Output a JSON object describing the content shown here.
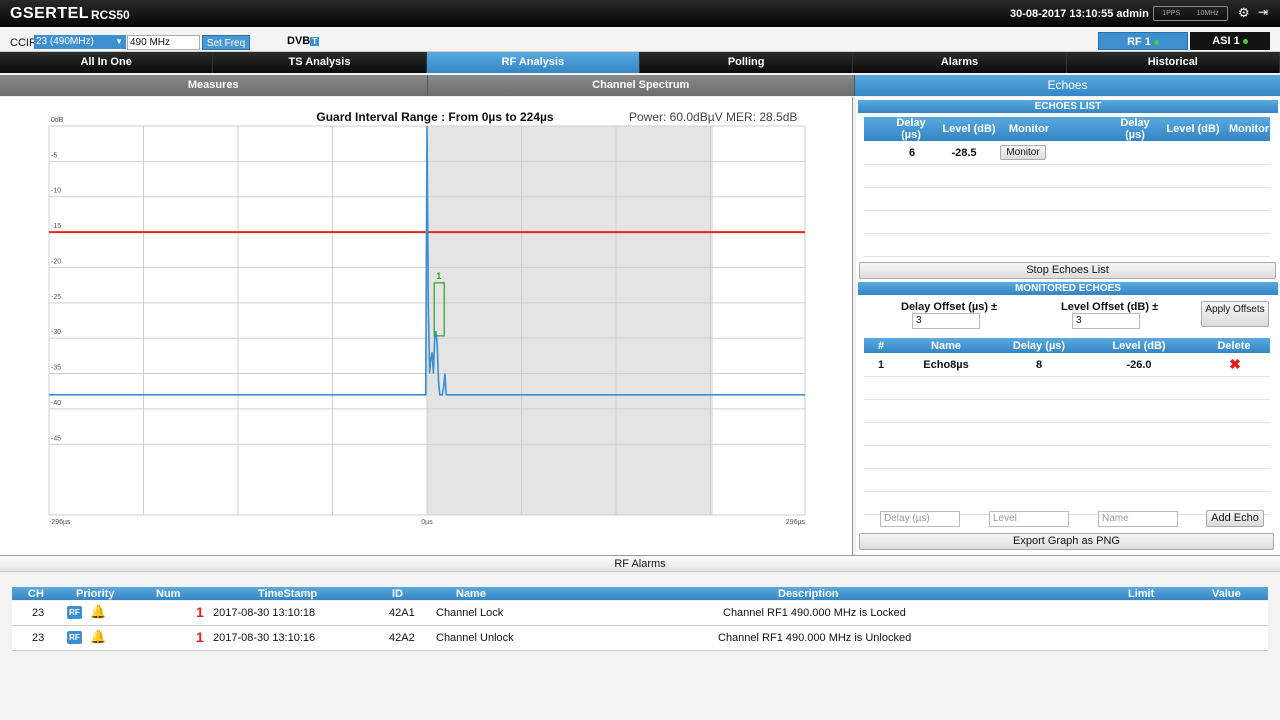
{
  "header": {
    "brand": "GSERTEL",
    "model": "RCS50",
    "datetime": "30-08-2017 13:10:55",
    "user": "admin",
    "pps_label": "1PPS",
    "ref_label": "10MHz"
  },
  "freqbar": {
    "ccir_label": "CCIR",
    "ccir_value": "23 (490MHz)",
    "freq_value": "490 MHz",
    "set_freq_label": "Set Freq",
    "dvb_label": "DVB",
    "dvb_suffix": "T",
    "rf_button": "RF 1",
    "asi_button": "ASI 1"
  },
  "main_tabs": [
    "All In One",
    "TS Analysis",
    "RF Analysis",
    "Polling",
    "Alarms",
    "Historical"
  ],
  "active_main_tab": "RF Analysis",
  "sub_tabs": [
    "Measures",
    "Channel Spectrum"
  ],
  "echoes_tab": "Echoes",
  "chart": {
    "title": "Guard Interval Range : From 0µs to 224µs",
    "power": "Power: 60.0dBµV",
    "mer": "MER: 28.5dB"
  },
  "chart_data": {
    "type": "line",
    "title": "Guard Interval Range : From 0µs to 224µs",
    "xlabel": "",
    "ylabel": "",
    "xlim": [
      -296,
      296
    ],
    "ylim": [
      -55,
      0
    ],
    "y_ticks": [
      "0dB",
      "-5",
      "-10",
      "-15",
      "-20",
      "-25",
      "-30",
      "-35",
      "-40",
      "-45"
    ],
    "x_ticks": [
      "-296µs",
      "0µs",
      "296µs"
    ],
    "threshold_db": -15,
    "guard_interval_us": [
      0,
      224
    ],
    "marker": {
      "label": "1",
      "delay_us": 8,
      "level_db": -26
    },
    "grid": true,
    "series": [
      {
        "x": [
          -296,
          -1,
          0,
          1,
          2,
          3,
          4,
          5,
          6,
          7,
          8,
          9,
          10,
          11,
          12,
          13,
          14,
          15,
          16,
          296
        ],
        "y": [
          -38,
          -38,
          0,
          -25,
          -35,
          -33,
          -32,
          -35,
          -30,
          -29,
          -31,
          -36,
          -38,
          -38,
          -38,
          -37,
          -35,
          -38,
          -38,
          -38
        ]
      }
    ]
  },
  "echoes_list": {
    "header": "ECHOES LIST",
    "columns": [
      "Delay (µs)",
      "Level (dB)",
      "Monitor",
      "Delay (µs)",
      "Level (dB)",
      "Monitor"
    ],
    "rows": [
      {
        "delay": "6",
        "level": "-28.5",
        "monitor": "Monitor"
      }
    ],
    "stop_button": "Stop Echoes List"
  },
  "monitored_echoes": {
    "header": "MONITORED ECHOES",
    "delay_offset_label": "Delay Offset (µs) ±",
    "delay_offset_value": "3",
    "level_offset_label": "Level Offset (dB) ±",
    "level_offset_value": "3",
    "apply_button": "Apply Offsets",
    "columns": [
      "#",
      "Name",
      "Delay (µs)",
      "Level (dB)",
      "Delete"
    ],
    "rows": [
      {
        "num": "1",
        "name": "Echo8µs",
        "delay": "8",
        "level": "-26.0"
      }
    ],
    "delay_placeholder": "Delay (µs)",
    "level_placeholder": "Level",
    "name_placeholder": "Name",
    "add_button": "Add Echo",
    "export_button": "Export Graph as PNG"
  },
  "alarms": {
    "title": "RF Alarms",
    "columns": [
      "CH",
      "Priority",
      "Num",
      "TimeStamp",
      "ID",
      "Name",
      "Description",
      "Limit",
      "Value"
    ],
    "rows": [
      {
        "ch": "23",
        "badge": "RF",
        "num": "1",
        "timestamp": "2017-08-30 13:10:18",
        "id": "42A1",
        "name": "Channel Lock",
        "description": "Channel RF1 490.000 MHz is Locked",
        "limit": "",
        "value": ""
      },
      {
        "ch": "23",
        "badge": "RF",
        "num": "1",
        "timestamp": "2017-08-30 13:10:16",
        "id": "42A2",
        "name": "Channel Unlock",
        "description": "Channel RF1 490.000 MHz is Unlocked",
        "limit": "",
        "value": ""
      }
    ]
  },
  "colors": {
    "accent": "#3d8fcf",
    "trace": "#3a8fd0",
    "threshold": "#e8231e",
    "marker": "#2aa02a",
    "guard_zone": "#e4e4e4"
  }
}
